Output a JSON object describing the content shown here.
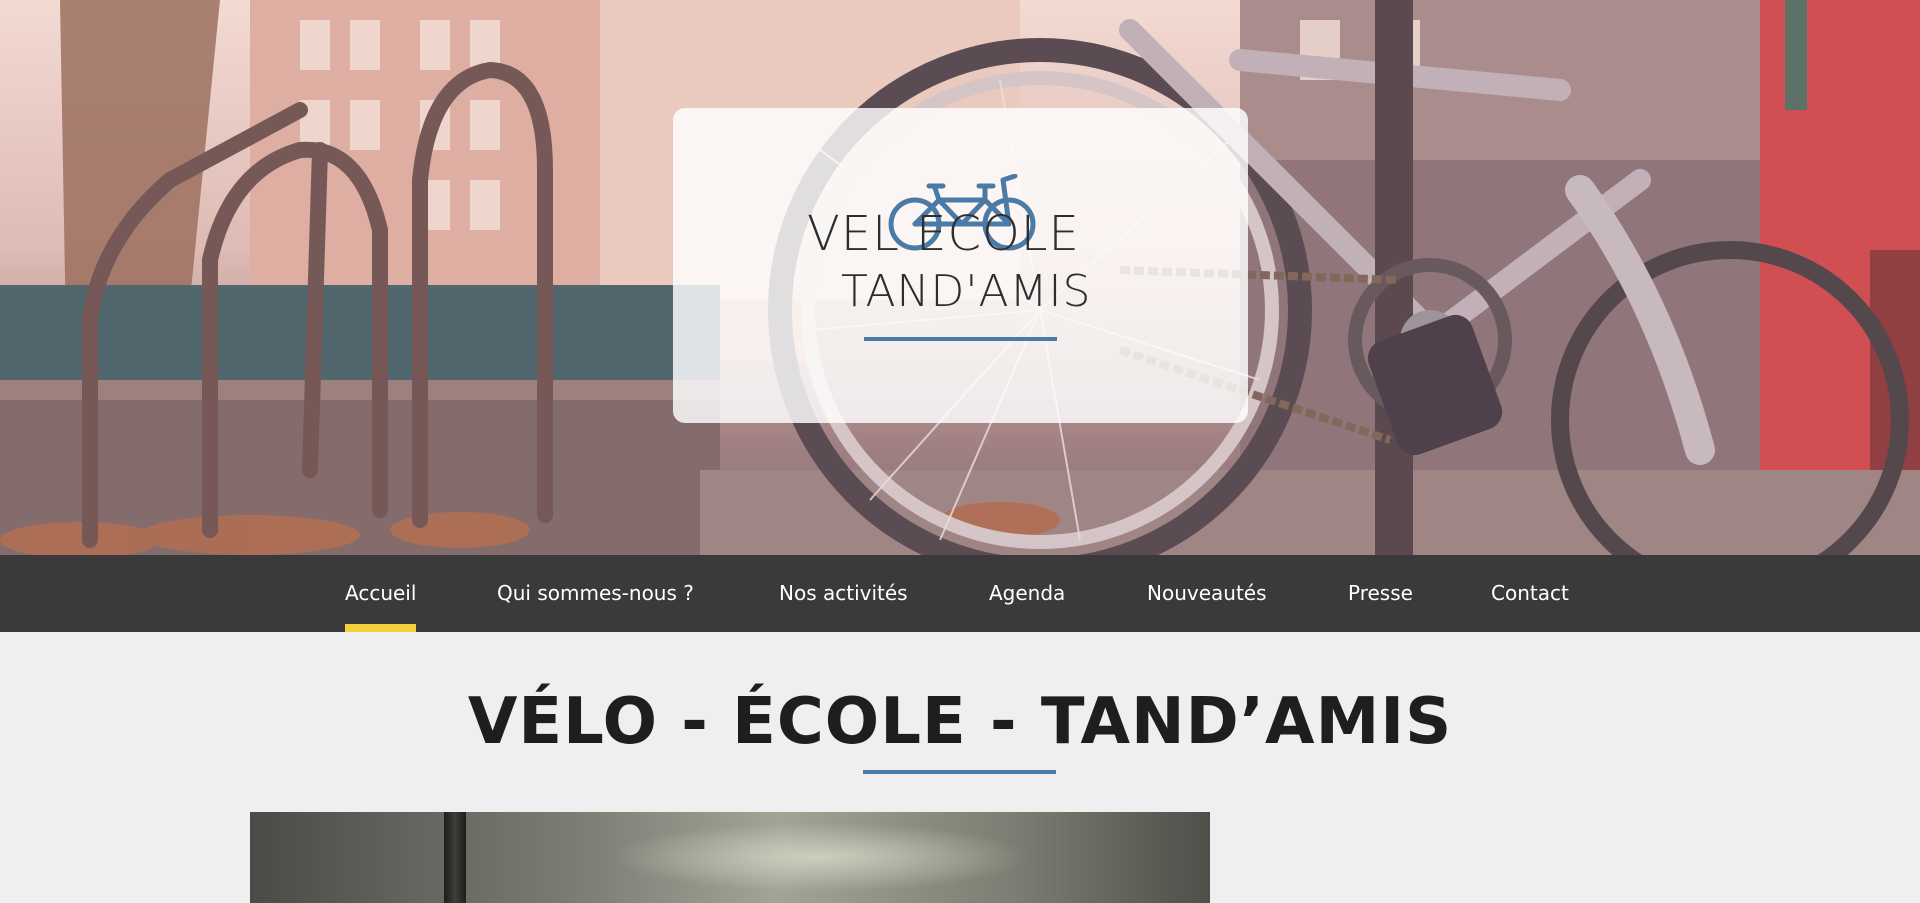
{
  "site": {
    "logo": {
      "line1": "VEL  ECOLE",
      "line2": "TAND'AMIS",
      "accent_color": "#4a7aa6"
    }
  },
  "nav": {
    "items": [
      {
        "label": "Accueil",
        "active": true
      },
      {
        "label": "Qui sommes-nous ?"
      },
      {
        "label": "Nos activités"
      },
      {
        "label": "Agenda"
      },
      {
        "label": "Nouveautés"
      },
      {
        "label": "Presse"
      },
      {
        "label": "Contact"
      }
    ],
    "active_indicator_color": "#f3d13a",
    "background_color": "#3a3a3a"
  },
  "main": {
    "title": "VÉLO - ÉCOLE - TAND’AMIS",
    "underline_color": "#4a7aa6"
  },
  "icons": {
    "logo_mark": "tandem-bike-icon"
  }
}
